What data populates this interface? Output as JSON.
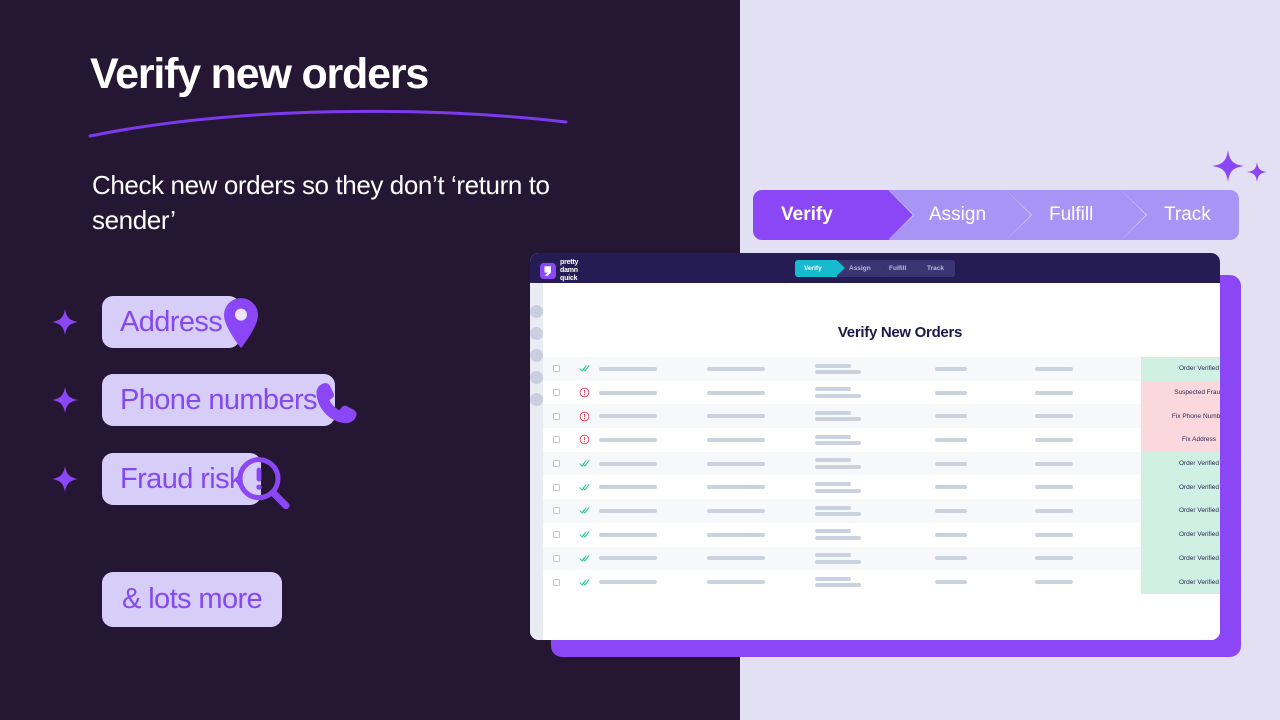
{
  "colors": {
    "dark_bg": "#251733",
    "light_bg": "#E3E0F3",
    "purple": "#8B47F5",
    "purple_light": "#A894F5",
    "pill_bg": "#D6CDF8",
    "pill_text": "#8549F2",
    "app_navy": "#241C53",
    "teal": "#16BBCF",
    "badge_green": "#CFF0E3",
    "badge_pink": "#FBD7DE"
  },
  "hero": {
    "headline": "Verify new orders",
    "subhead": "Check new orders so they don’t ‘return to sender’"
  },
  "features": [
    {
      "label": "Address",
      "icon": "map-pin-icon"
    },
    {
      "label": "Phone numbers",
      "icon": "phone-icon"
    },
    {
      "label": "Fraud risk",
      "icon": "magnifier-alert-icon"
    }
  ],
  "more_pill": {
    "label": "& lots more"
  },
  "steps": [
    {
      "label": "Verify",
      "active": true
    },
    {
      "label": "Assign",
      "active": false
    },
    {
      "label": "Fulfill",
      "active": false
    },
    {
      "label": "Track",
      "active": false
    }
  ],
  "app": {
    "logo": {
      "line1": "pretty",
      "line2": "damn",
      "line3": "quick"
    },
    "steps": [
      {
        "label": "Verify",
        "active": true
      },
      {
        "label": "Assign",
        "active": false
      },
      {
        "label": "Fulfill",
        "active": false
      },
      {
        "label": "Track",
        "active": false
      }
    ],
    "page_title": "Verify New Orders",
    "rail_dots": 5,
    "rows": [
      {
        "status_icon": "double-check-icon",
        "badge": "Order Verified",
        "badge_type": "green"
      },
      {
        "status_icon": "alert-circle-icon",
        "badge": "Suspected Fraud",
        "badge_type": "pink"
      },
      {
        "status_icon": "alert-circle-icon",
        "badge": "Fix Phone Number",
        "badge_type": "pink"
      },
      {
        "status_icon": "alert-circle-icon",
        "badge": "Fix Address",
        "badge_type": "pink"
      },
      {
        "status_icon": "double-check-icon",
        "badge": "Order Verified",
        "badge_type": "green"
      },
      {
        "status_icon": "double-check-icon",
        "badge": "Order Verified",
        "badge_type": "green"
      },
      {
        "status_icon": "double-check-icon",
        "badge": "Order Verified",
        "badge_type": "green"
      },
      {
        "status_icon": "double-check-icon",
        "badge": "Order Verified",
        "badge_type": "green"
      },
      {
        "status_icon": "double-check-icon",
        "badge": "Order Verified",
        "badge_type": "green"
      },
      {
        "status_icon": "double-check-icon",
        "badge": "Order Verified",
        "badge_type": "green"
      }
    ]
  }
}
